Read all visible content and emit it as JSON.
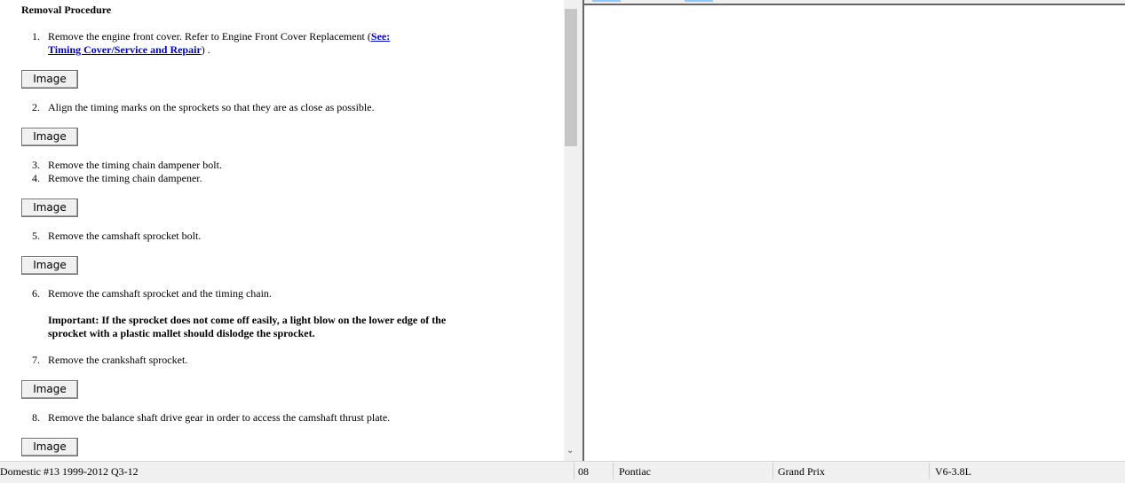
{
  "procedure": {
    "heading": "Removal Procedure",
    "steps": [
      {
        "n": "1.",
        "text": "Remove the engine front cover. Refer to Engine Front Cover Replacement ",
        "link": "See:",
        "link2": "Timing Cover/Service and Repair",
        "after": ") ."
      },
      {
        "n": "2.",
        "text": "Align the timing marks on the sprockets so that they are as close as possible."
      },
      {
        "n": "3.",
        "text": "Remove the timing chain dampener bolt."
      },
      {
        "n": "4.",
        "text": "Remove the timing chain dampener."
      },
      {
        "n": "5.",
        "text": "Remove the camshaft sprocket bolt."
      },
      {
        "n": "6.",
        "text": "Remove the camshaft sprocket and the timing chain."
      },
      {
        "n": "7.",
        "text": "Remove the crankshaft sprocket."
      },
      {
        "n": "8.",
        "text": "Remove the balance shaft drive gear in order to access the camshaft thrust plate."
      }
    ],
    "important": "Important:  If the sprocket does not come off easily, a light blow on the lower edge of the sprocket with a plastic mallet should dislodge the sprocket.",
    "image_button": "Image"
  },
  "scroll_down": "⌄",
  "status": {
    "database": "Domestic #13 1999-2012 Q3-12",
    "year": "08",
    "make": "Pontiac",
    "model": "Grand Prix",
    "engine": "V6-3.8L"
  }
}
